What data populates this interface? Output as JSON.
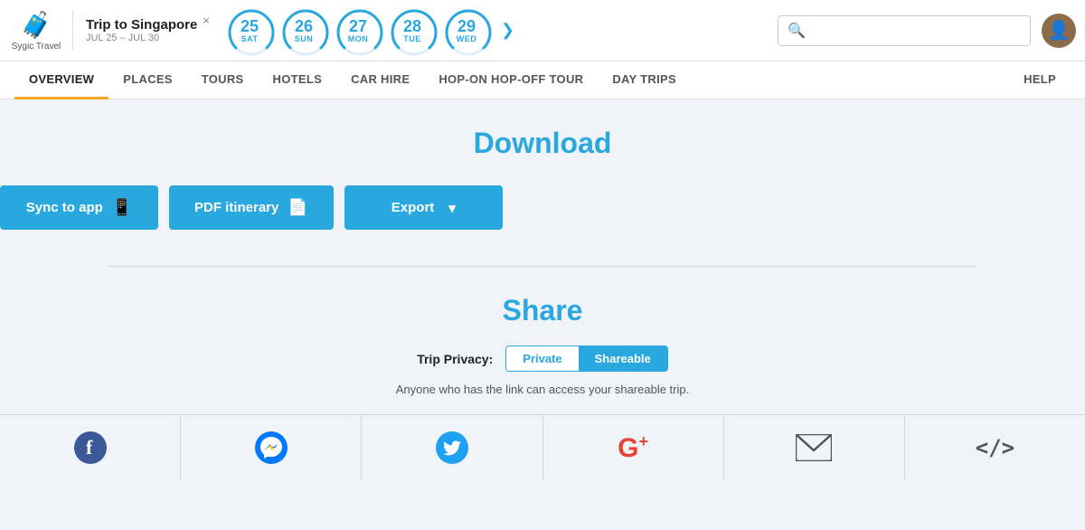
{
  "header": {
    "brand": {
      "icon": "🧳",
      "label": "Sygic Travel"
    },
    "trip": {
      "title": "Trip to Singapore",
      "dates": "JUL 25 – JUL 30",
      "close": "×"
    },
    "days": [
      {
        "num": "25",
        "label": "SAT",
        "active": false
      },
      {
        "num": "26",
        "label": "SUN",
        "active": true
      },
      {
        "num": "27",
        "label": "MON",
        "active": false
      },
      {
        "num": "28",
        "label": "TUE",
        "active": false
      },
      {
        "num": "29",
        "label": "WED",
        "active": false
      }
    ],
    "nav_arrow": "❯",
    "search_placeholder": ""
  },
  "nav": {
    "tabs": [
      {
        "label": "OVERVIEW",
        "active": true
      },
      {
        "label": "PLACES",
        "active": false
      },
      {
        "label": "TOURS",
        "active": false
      },
      {
        "label": "HOTELS",
        "active": false
      },
      {
        "label": "CAR HIRE",
        "active": false
      },
      {
        "label": "HOP-ON HOP-OFF TOUR",
        "active": false
      },
      {
        "label": "DAY TRIPS",
        "active": false
      }
    ],
    "help": "HELP"
  },
  "download": {
    "title": "Download",
    "sync_label": "Sync to app",
    "sync_icon": "📱",
    "pdf_label": "PDF itinerary",
    "pdf_icon": "📄",
    "export_label": "Export",
    "export_arrow": "▾"
  },
  "share": {
    "title": "Share",
    "privacy_label": "Trip Privacy:",
    "private_label": "Private",
    "shareable_label": "Shareable",
    "desc": "Anyone who has the link can access your shareable trip.",
    "socials": [
      {
        "name": "facebook",
        "label": "f",
        "color": "#3b5998"
      },
      {
        "name": "messenger",
        "label": "m",
        "color": "#0078FF"
      },
      {
        "name": "twitter",
        "label": "t",
        "color": "#1da1f2"
      },
      {
        "name": "google-plus",
        "label": "G+",
        "color": "#ea4335"
      },
      {
        "name": "email",
        "label": "✉",
        "color": "#555"
      },
      {
        "name": "embed",
        "label": "</>",
        "color": "#555"
      }
    ]
  }
}
